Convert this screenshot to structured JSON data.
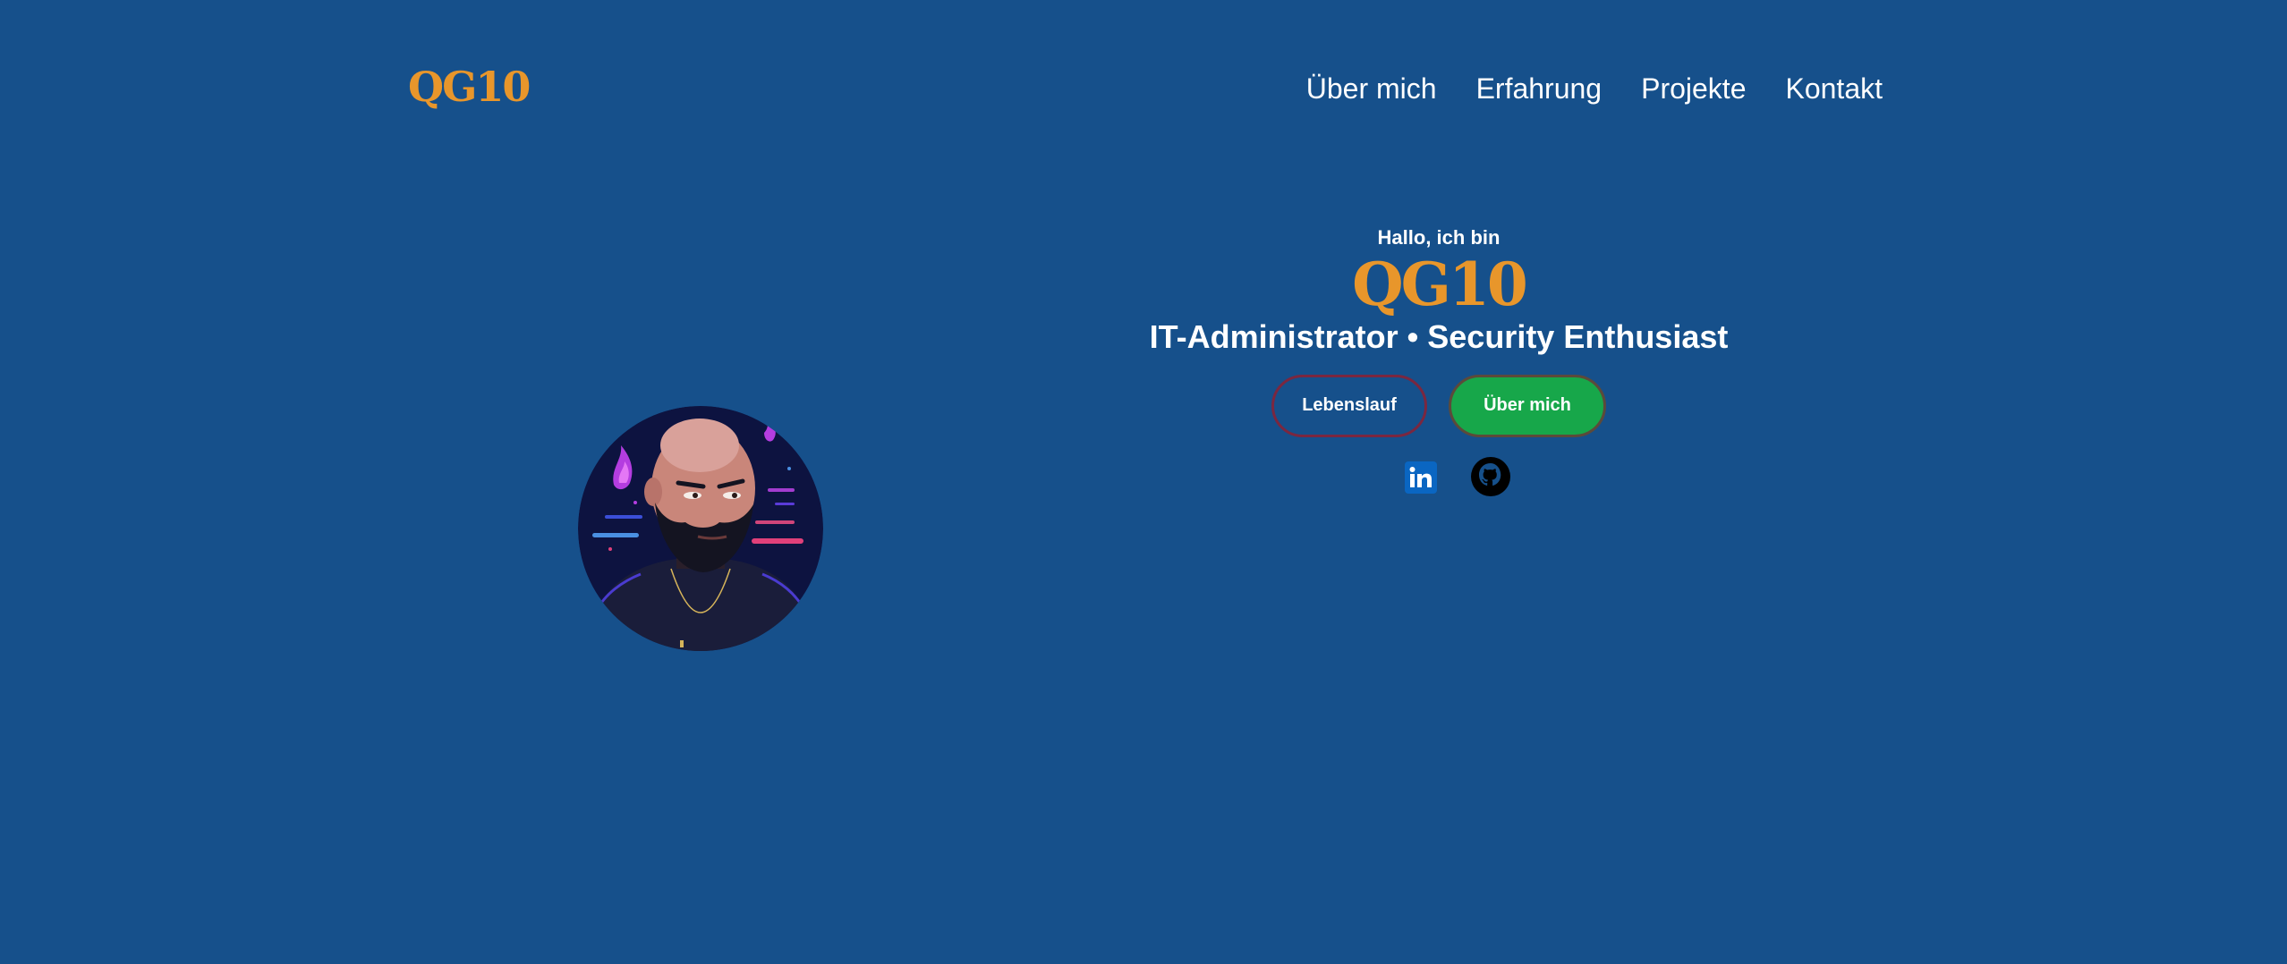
{
  "header": {
    "logo_text": "QG10",
    "nav": [
      {
        "label": "Über mich"
      },
      {
        "label": "Erfahrung"
      },
      {
        "label": "Projekte"
      },
      {
        "label": "Kontakt"
      }
    ]
  },
  "hero": {
    "greeting": "Hallo, ich bin",
    "name": "QG10",
    "tagline": "IT-Administrator • Security Enthusiast",
    "buttons": {
      "cv_label": "Lebenslauf",
      "about_label": "Über mich"
    },
    "socials": [
      {
        "name": "linkedin-icon"
      },
      {
        "name": "github-icon"
      }
    ]
  },
  "colors": {
    "background": "#16508b",
    "accent": "#e8962b",
    "button_primary": "#17a74a",
    "button_outline": "#7a2740",
    "linkedin": "#0a66c2"
  }
}
